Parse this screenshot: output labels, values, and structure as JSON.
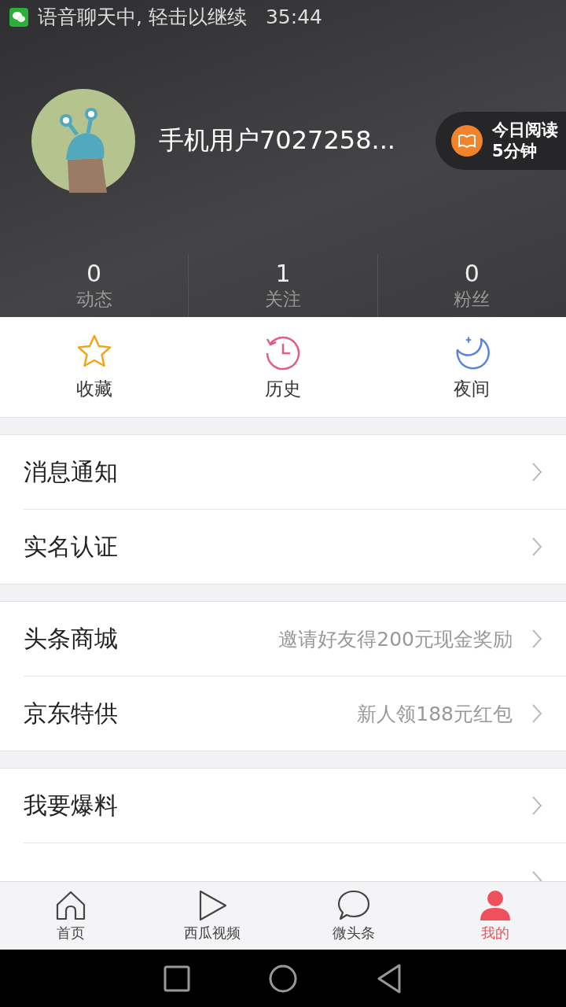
{
  "status_bar": {
    "notification": "语音聊天中, 轻击以继续",
    "time": "35:44"
  },
  "profile": {
    "name": "手机用户7027258...",
    "reading_badge": {
      "line_1": "今日阅读",
      "line_2": "5分钟"
    }
  },
  "stats": [
    {
      "value": "0",
      "label": "动态"
    },
    {
      "value": "1",
      "label": "关注"
    },
    {
      "value": "0",
      "label": "粉丝"
    }
  ],
  "shortcuts": [
    {
      "kind": "star",
      "label": "收藏"
    },
    {
      "kind": "history",
      "label": "历史"
    },
    {
      "kind": "moon",
      "label": "夜间"
    }
  ],
  "menu_groups": [
    [
      {
        "label": "消息通知"
      },
      {
        "label": "实名认证"
      }
    ],
    [
      {
        "label": "头条商城",
        "hint": "邀请好友得200元现金奖励"
      },
      {
        "label": "京东特供",
        "hint": "新人领188元红包"
      }
    ],
    [
      {
        "label": "我要爆料"
      }
    ]
  ],
  "list_continues_below": true,
  "tabs": [
    {
      "kind": "home",
      "label": "首页",
      "selected": false
    },
    {
      "kind": "video",
      "label": "西瓜视频",
      "selected": false
    },
    {
      "kind": "chat",
      "label": "微头条",
      "selected": false
    },
    {
      "kind": "person",
      "label": "我的",
      "selected": true
    }
  ]
}
